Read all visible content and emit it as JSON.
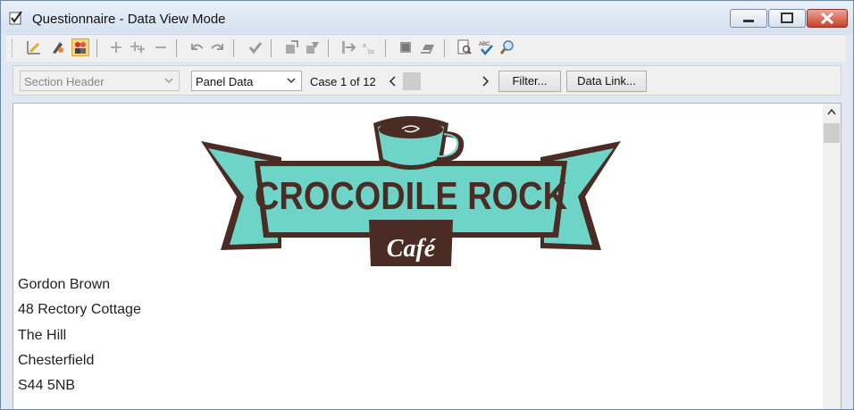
{
  "window": {
    "title": "Questionnaire - Data View Mode"
  },
  "toolbar": {
    "icons": [
      "edit-icon",
      "pen-icon",
      "people-icon",
      "add-icon",
      "add-multiple-icon",
      "remove-icon",
      "undo-icon",
      "redo-icon",
      "check-icon",
      "move-up-icon",
      "move-icon",
      "export-icon",
      "sort-icon",
      "stop-icon",
      "layers-icon",
      "preview-icon",
      "spellcheck-icon",
      "find-icon"
    ]
  },
  "nav": {
    "section_combo": "Section Header",
    "panel_combo": "Panel Data",
    "case_label": "Case 1 of 12",
    "filter_button": "Filter...",
    "datalink_button": "Data Link..."
  },
  "logo": {
    "name": "CROCODILE ROCK",
    "sub": "Café",
    "colors": {
      "teal": "#6fd4c8",
      "brown": "#4a2c24"
    }
  },
  "address": {
    "lines": [
      "Gordon Brown",
      "48 Rectory Cottage",
      "The Hill",
      "Chesterfield",
      "S44 5NB"
    ]
  }
}
